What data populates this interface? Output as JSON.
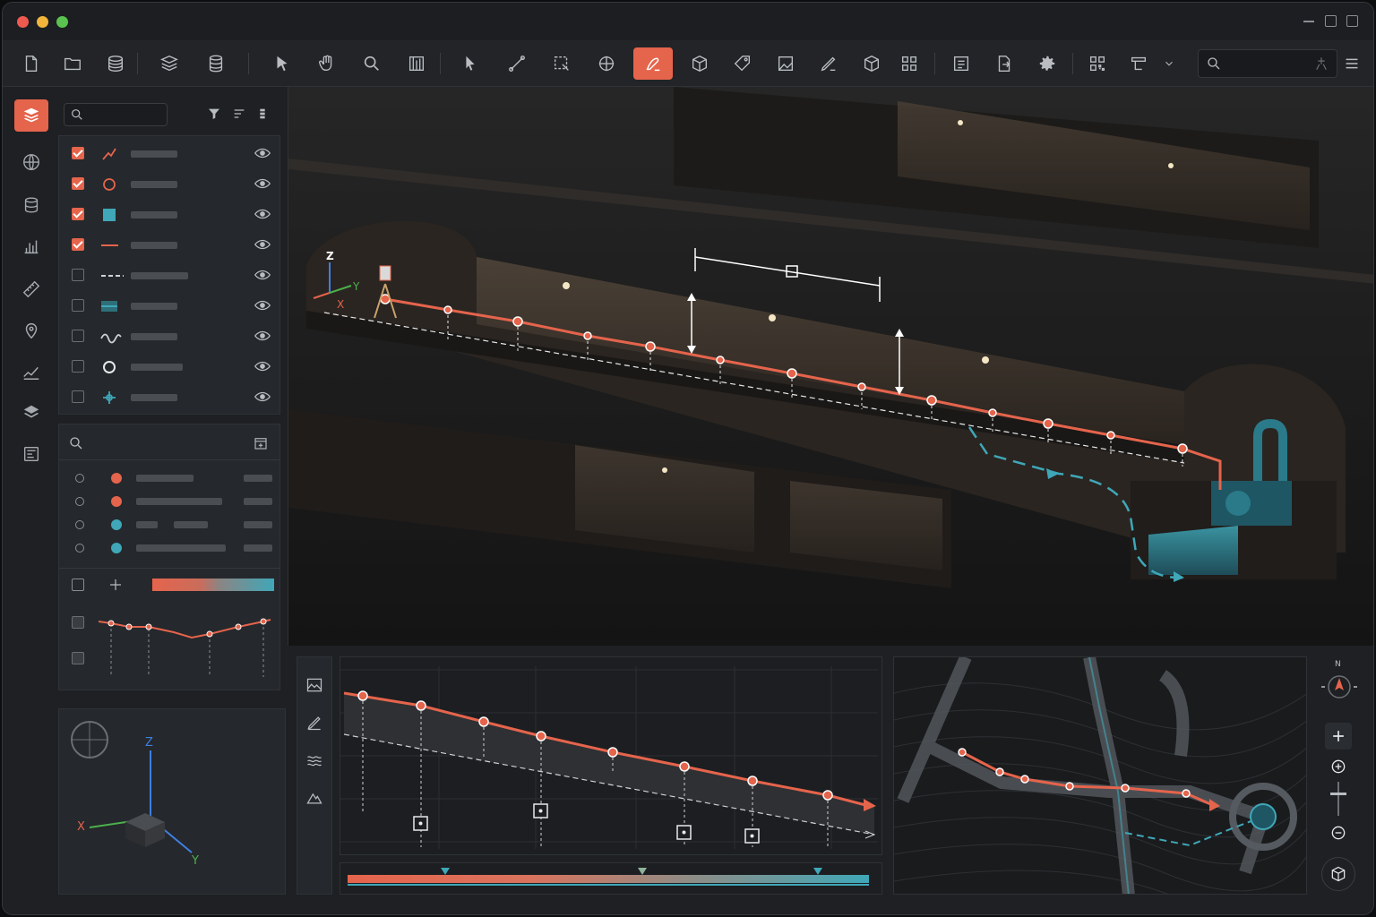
{
  "window": {
    "controls": [
      "close",
      "minimize",
      "zoom"
    ],
    "colors": {
      "accent": "#e5644c",
      "teal": "#3fa7b8",
      "bg": "#1e2023",
      "panel": "#25282c"
    }
  },
  "toolbar": {
    "icons": [
      "new-file-icon",
      "open-folder-icon",
      "layers-stack-icon",
      "layers-alt-icon",
      "database-icon",
      "select-arrow-icon",
      "pan-hand-icon",
      "zoom-icon",
      "section-icon",
      "pointer-icon",
      "line-draw-icon",
      "area-select-icon",
      "crosshair-icon",
      "sketch-tool-icon",
      "cube-icon",
      "tag-icon",
      "raster-icon",
      "pen-icon",
      "box-3d-icon",
      "grid-icon",
      "report-icon",
      "export-icon",
      "settings-gear-icon",
      "qr-icon",
      "profile-tool-icon",
      "dropdown-chevron-icon",
      "search-icon",
      "pin-icon",
      "menu-icon"
    ],
    "active_tool": "sketch-tool-icon"
  },
  "left_rail": {
    "icons": [
      "layers-icon",
      "globe-icon",
      "database-icon",
      "bar-chart-icon",
      "ruler-icon",
      "location-pin-icon",
      "chart-line-icon",
      "stack-icon",
      "document-icon"
    ],
    "active": "layers-icon"
  },
  "layers_panel": {
    "items": [
      {
        "checked": true,
        "symbol": "polyline",
        "color": "#e5644c"
      },
      {
        "checked": true,
        "symbol": "circle",
        "color": "#e5644c"
      },
      {
        "checked": true,
        "symbol": "square",
        "color": "#3fa7b8"
      },
      {
        "checked": true,
        "symbol": "line",
        "color": "#e5644c"
      },
      {
        "checked": false,
        "symbol": "dashed",
        "color": "#cfd2d6"
      },
      {
        "checked": false,
        "symbol": "hatch",
        "color": "#3fa7b8"
      },
      {
        "checked": false,
        "symbol": "wave",
        "color": "#cfd2d6"
      },
      {
        "checked": false,
        "symbol": "ring",
        "color": "#cfd2d6"
      },
      {
        "checked": false,
        "symbol": "target",
        "color": "#3fa7b8"
      }
    ]
  },
  "attribute_panel": {
    "rows": [
      {
        "color": "#e5644c"
      },
      {
        "color": "#e5644c"
      },
      {
        "color": "#3fa7b8"
      },
      {
        "color": "#3fa7b8"
      }
    ]
  },
  "axes_gizmo": {
    "x": "X",
    "y": "Y",
    "z": "Z"
  },
  "viewport": {
    "axis_labels": {
      "x": "X",
      "y": "Y",
      "z": "Z"
    }
  },
  "profile_panel": {
    "icons": [
      "terrain-icon",
      "pen-profile-icon",
      "waves-icon",
      "mountain-icon"
    ]
  },
  "map_panel": {
    "compass": "N",
    "controls": [
      "zoom-in-button",
      "zoom-in-small-button",
      "zoom-out-button",
      "view-3d-button"
    ]
  }
}
